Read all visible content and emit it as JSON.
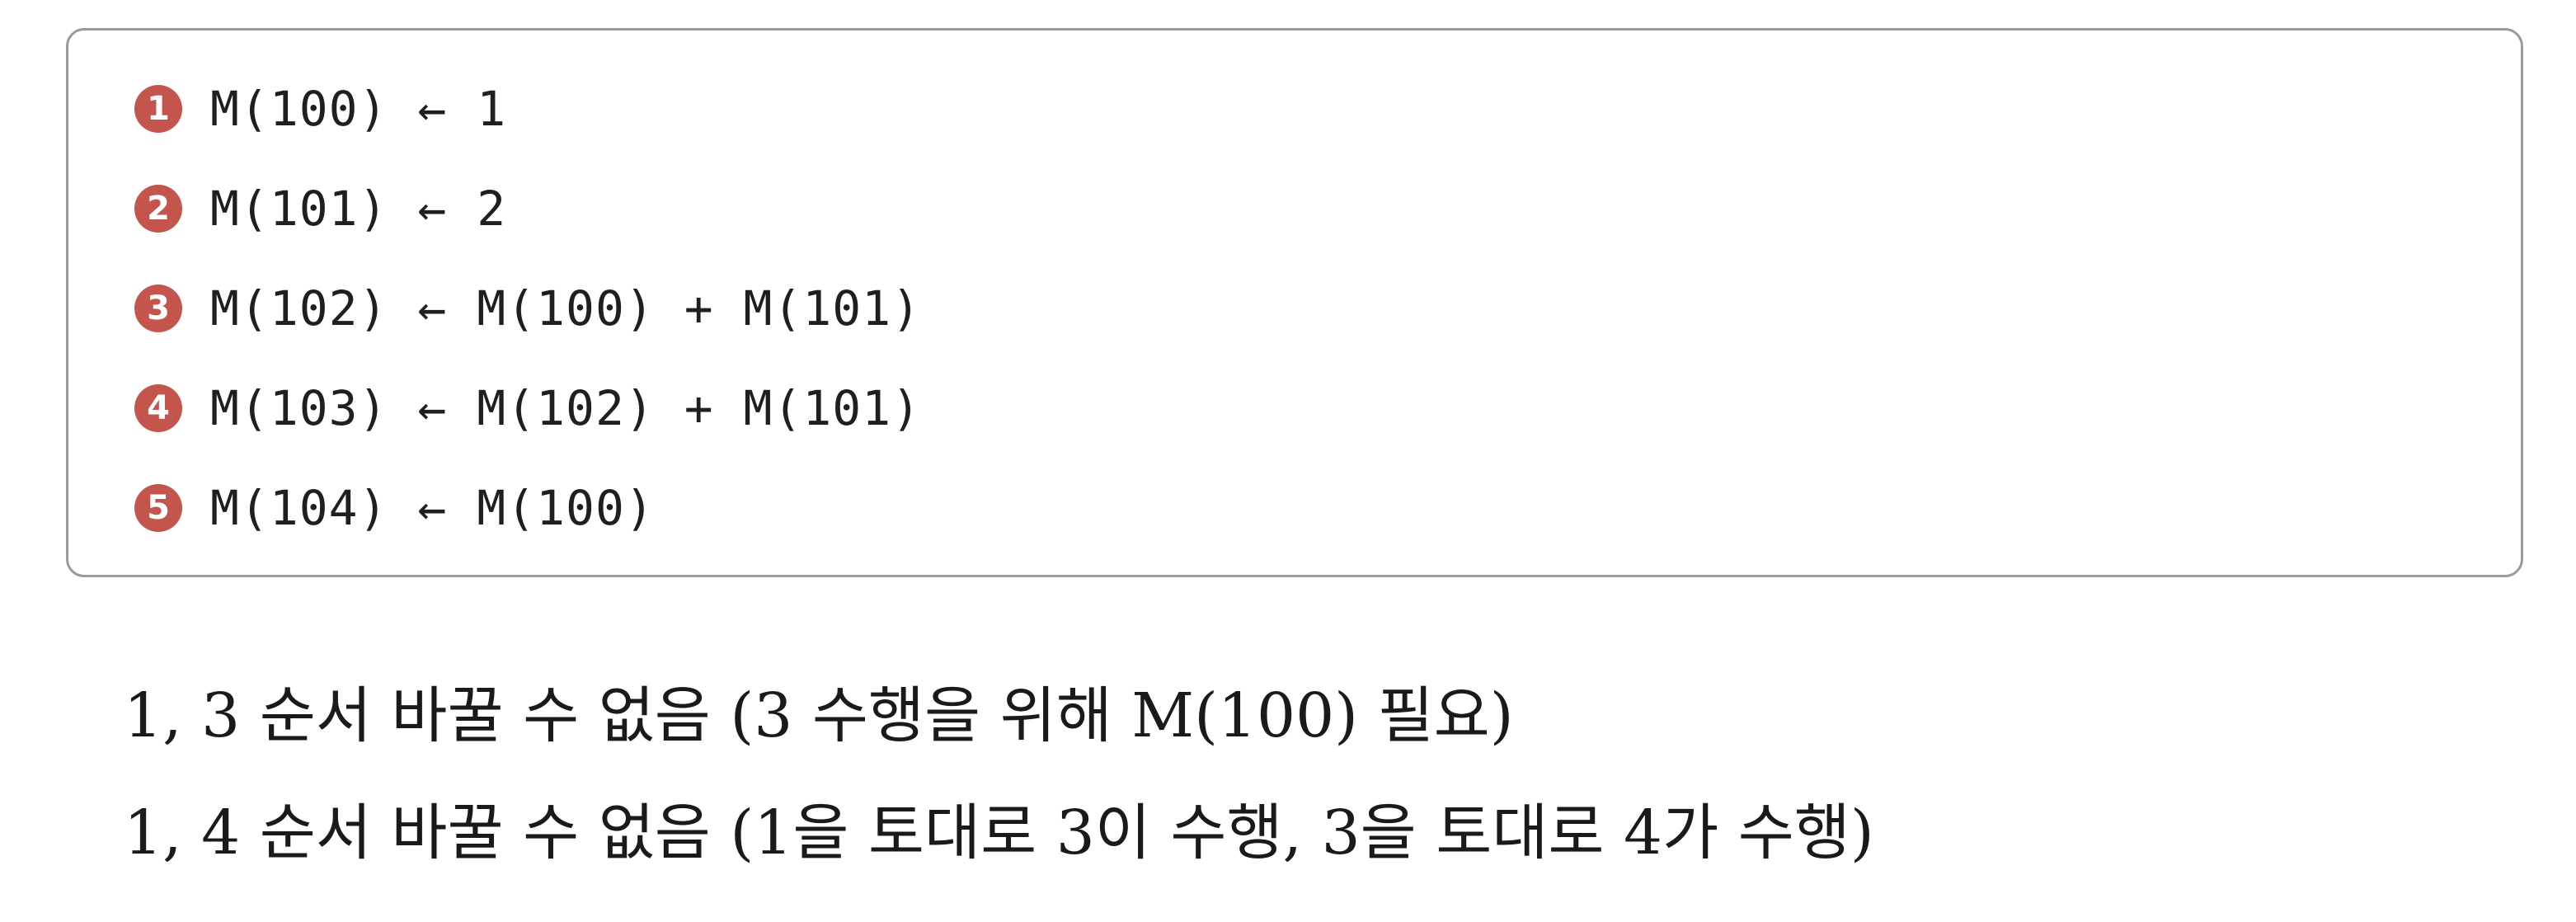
{
  "code_block": {
    "lines": [
      {
        "num": "1",
        "text": "M(100) ← 1"
      },
      {
        "num": "2",
        "text": "M(101) ← 2"
      },
      {
        "num": "3",
        "text": "M(102) ← M(100) + M(101)"
      },
      {
        "num": "4",
        "text": "M(103) ← M(102) + M(101)"
      },
      {
        "num": "5",
        "text": "M(104) ← M(100)"
      }
    ]
  },
  "notes": [
    "1, 3 순서 바꿀 수 없음 (3 수행을 위해 M(100) 필요)",
    "1, 4 순서 바꿀 수 없음 (1을 토대로 3이 수행, 3을 토대로 4가 수행)"
  ],
  "colors": {
    "badge": "#c4554d",
    "border": "#9a9a9a"
  }
}
